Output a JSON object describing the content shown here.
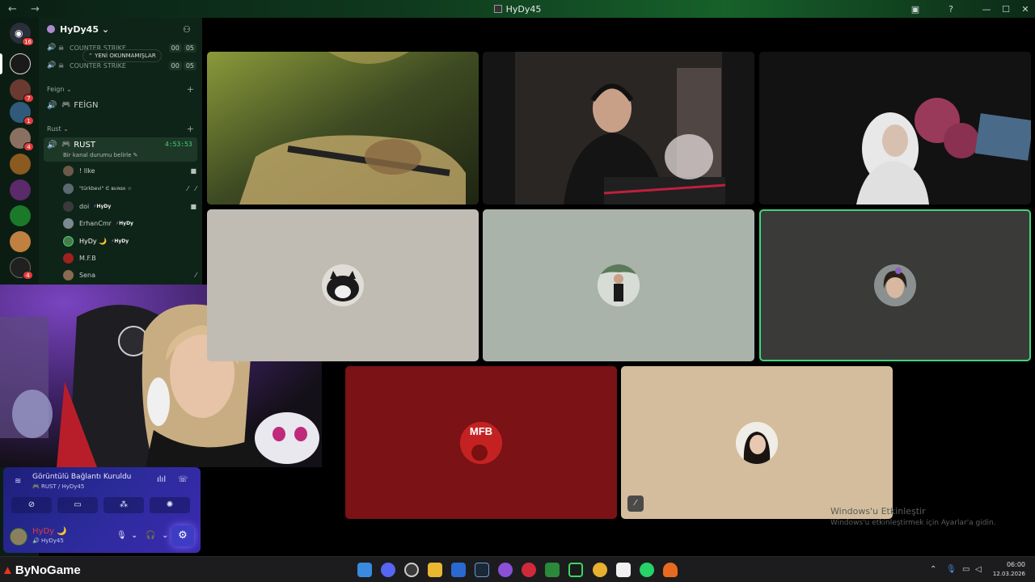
{
  "window": {
    "title": "HyDy45",
    "back_icon": "arrow-left-icon",
    "forward_icon": "arrow-right-icon",
    "inbox_icon": "inbox-icon",
    "help_icon": "help-icon"
  },
  "rail": {
    "home_badge": "16",
    "servers": [
      {
        "name": "server-hydy",
        "badge": ""
      },
      {
        "name": "server-2",
        "badge": "7"
      },
      {
        "name": "server-3",
        "badge": "1"
      },
      {
        "name": "server-4",
        "badge": "4"
      },
      {
        "name": "server-5",
        "badge": ""
      },
      {
        "name": "server-6",
        "badge": ""
      },
      {
        "name": "server-7",
        "badge": ""
      },
      {
        "name": "server-8",
        "badge": ""
      },
      {
        "name": "server-9",
        "badge": "4"
      }
    ]
  },
  "sidebar": {
    "server_name": "HyDy45",
    "channels_top": [
      {
        "label": "COUNTER STRIKE",
        "count_a": "00",
        "count_b": "05"
      },
      {
        "label": "COUNTER STRIKE",
        "count_a": "00",
        "count_b": "05"
      }
    ],
    "unread_label": "YENİ OKUNMAMIŞLAR",
    "categories": [
      {
        "label": "Feign",
        "channel": "FEİGN"
      },
      {
        "label": "Rust",
        "channel": "RUST"
      }
    ],
    "active_timer": "4:53:53",
    "status_prompt": "Bir kanal durumu belirle",
    "members": [
      {
        "name": "! Ilke",
        "tag": "",
        "color": "#6b5a4a"
      },
      {
        "name": "\"türkbevi\" ∈ вυяαк ☆",
        "tag": "",
        "color": "#5a6a70"
      },
      {
        "name": "doi",
        "tag": "HyDy",
        "color": "#3a3a3a"
      },
      {
        "name": "ErhanCmr",
        "tag": "HyDy",
        "color": "#7a8a90"
      },
      {
        "name": "HyDy 🌙",
        "tag": "HyDy",
        "color": "#4a7a4a"
      },
      {
        "name": "M.F.B",
        "tag": "",
        "color": "#a02020"
      },
      {
        "name": "Sena",
        "tag": "",
        "color": "#8a6a50"
      }
    ]
  },
  "voice_panel": {
    "status": "Görüntülü Bağlantı Kuruldu",
    "path": "RUST / HyDy45",
    "user_name": "HyDy 🌙",
    "user_sub": "HyDy45"
  },
  "tiles": [
    {
      "name": "tile-guitar",
      "bg": "#3a4020"
    },
    {
      "name": "tile-headset-man",
      "bg": "#1a1a1a"
    },
    {
      "name": "tile-white-hoodie",
      "bg": "#141414"
    },
    {
      "name": "tile-cat",
      "bg": "#c0bcb4"
    },
    {
      "name": "tile-suit",
      "bg": "#a9b3aa"
    },
    {
      "name": "tile-woman",
      "bg": "#3a3a38"
    },
    {
      "name": "tile-mfb",
      "bg": "#7a1216",
      "label": "MFB"
    },
    {
      "name": "tile-girl",
      "bg": "#d3bd9c"
    }
  ],
  "watermark": {
    "title": "Windows'u Etkinleştir",
    "sub": "Windows'u etkinleştirmek için Ayarlar'a gidin."
  },
  "taskbar": {
    "brand": "ByNoGame",
    "time": "06:00",
    "date": "12.03.2026"
  },
  "colors": {
    "accent_green": "#3ed67b",
    "voice_panel": "#2c2b9b",
    "mention_red": "#e23c3c"
  }
}
